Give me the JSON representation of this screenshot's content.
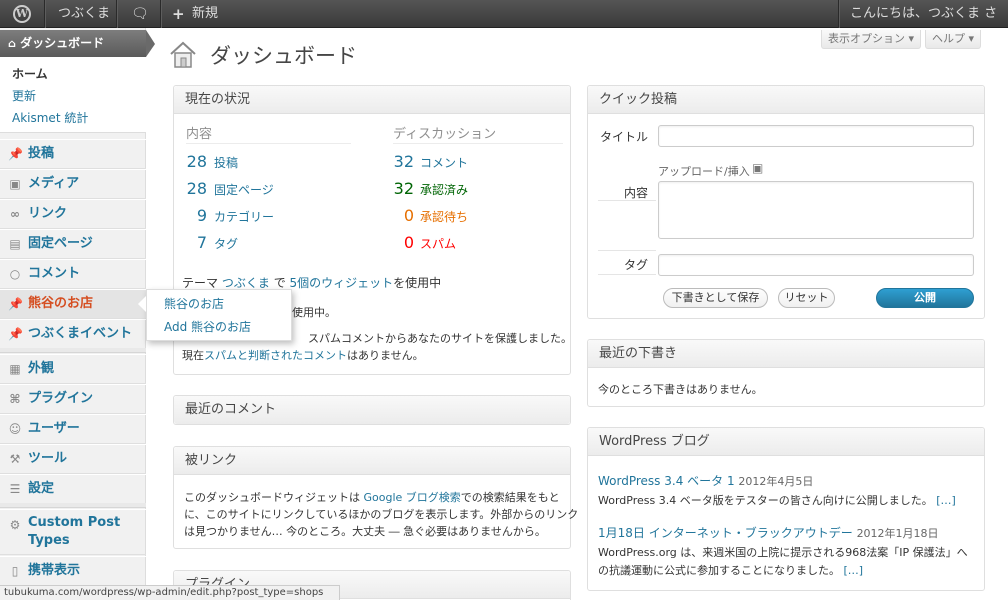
{
  "adminbar": {
    "site_name": "つぶくま",
    "new_label": "新規",
    "greeting": "こんにちは、つぶくま さん！"
  },
  "header": {
    "title": "ダッシュボード",
    "screen_options": "表示オプション ▾",
    "help": "ヘルプ ▾"
  },
  "sidebar": {
    "dashboard": "ダッシュボード",
    "sub": [
      "ホーム",
      "更新",
      "Akismet 統計"
    ],
    "items": [
      {
        "label": "投稿",
        "icon": "pin-icon"
      },
      {
        "label": "メディア",
        "icon": "media-icon"
      },
      {
        "label": "リンク",
        "icon": "link-icon"
      },
      {
        "label": "固定ページ",
        "icon": "page-icon"
      },
      {
        "label": "コメント",
        "icon": "comment-icon"
      },
      {
        "label": "熊谷のお店",
        "icon": "pin-icon"
      },
      {
        "label": "つぶくまイベント",
        "icon": "pin-icon"
      },
      {
        "label": "外観",
        "icon": "appearance-icon"
      },
      {
        "label": "プラグイン",
        "icon": "plugin-icon"
      },
      {
        "label": "ユーザー",
        "icon": "users-icon"
      },
      {
        "label": "ツール",
        "icon": "tools-icon"
      },
      {
        "label": "設定",
        "icon": "settings-icon"
      },
      {
        "label": "Custom Post Types",
        "icon": "gear-icon"
      },
      {
        "label": "携帯表示",
        "icon": "mobile-icon"
      }
    ],
    "flyout": [
      "熊谷のお店",
      "Add 熊谷のお店"
    ]
  },
  "right_now": {
    "title": "現在の状況",
    "content_heading": "内容",
    "discussion_heading": "ディスカッション",
    "content": [
      {
        "num": "28",
        "label": "投稿"
      },
      {
        "num": "28",
        "label": "固定ページ"
      },
      {
        "num": "9",
        "label": "カテゴリー"
      },
      {
        "num": "7",
        "label": "タグ"
      }
    ],
    "discussion": [
      {
        "num": "32",
        "label": "コメント",
        "color": "#21759b"
      },
      {
        "num": "32",
        "label": "承認済み",
        "color": "#006505"
      },
      {
        "num": "0",
        "label": "承認待ち",
        "color": "#e66f00"
      },
      {
        "num": "0",
        "label": "スパム",
        "color": "#ff0000"
      }
    ],
    "theme_prefix": "テーマ",
    "theme_name": "つぶくま",
    "theme_mid": "で",
    "widgets": "5個のウィジェット",
    "theme_suffix": "を使用中",
    "version_line_tail": "使用中。",
    "akismet_line": "スパムコメントからあなたのサイトを保護しました。",
    "spam_prefix": "現在",
    "spam_link": "スパムと判断されたコメント",
    "spam_suffix": "はありません。"
  },
  "recent_comments": {
    "title": "最近のコメント"
  },
  "incoming_links": {
    "title": "被リンク",
    "line1_a": "このダッシュボードウィジェットは",
    "line1_link": "Google ブログ検索",
    "line1_b": "での検索結果をもと",
    "line2": "に、このサイトにリンクしているほかのブログを表示します。外部からのリンク",
    "line3": "は見つかりません… 今のところ。大丈夫 ― 急ぐ必要はありませんから。"
  },
  "plugins_box": {
    "title": "プラグイン"
  },
  "quick_press": {
    "title": "クイック投稿",
    "title_label": "タイトル",
    "upload_label": "アップロード/挿入",
    "content_label": "内容",
    "tags_label": "タグ",
    "save_draft": "下書きとして保存",
    "reset": "リセット",
    "publish": "公開"
  },
  "recent_drafts": {
    "title": "最近の下書き",
    "empty": "今のところ下書きはありません。"
  },
  "wp_blog": {
    "title": "WordPress ブログ",
    "posts": [
      {
        "title": "WordPress 3.4 ベータ 1",
        "date": "2012年4月5日",
        "excerpt": "WordPress 3.4 ベータ版をテスターの皆さん向けに公開しました。",
        "more": "[…]"
      },
      {
        "title": "1月18日 インターネット・ブラックアウトデー",
        "date": "2012年1月18日",
        "excerpt1": "WordPress.org は、来週米国の上院に提示される968法案「IP 保護法」へ",
        "excerpt2": "の抗議運動に公式に参加することになりました。",
        "more": "[…]"
      }
    ]
  },
  "statusbar": "tubukuma.com/wordpress/wp-admin/edit.php?post_type=shops"
}
